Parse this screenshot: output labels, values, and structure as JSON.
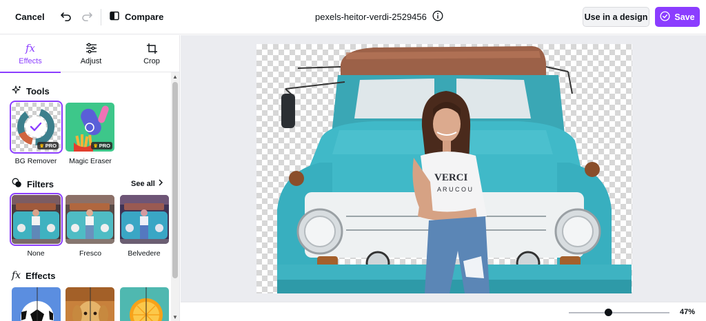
{
  "topbar": {
    "cancel_label": "Cancel",
    "compare_label": "Compare",
    "file_name": "pexels-heitor-verdi-2529456",
    "use_in_design_label": "Use in a design",
    "save_label": "Save"
  },
  "tabs": [
    {
      "label": "Effects",
      "icon": "fx-icon",
      "active": true
    },
    {
      "label": "Adjust",
      "icon": "sliders-icon",
      "active": false
    },
    {
      "label": "Crop",
      "icon": "crop-icon",
      "active": false
    }
  ],
  "sections": {
    "tools": {
      "title": "Tools",
      "items": [
        {
          "label": "BG Remover",
          "badge": "PRO",
          "selected": true
        },
        {
          "label": "Magic Eraser",
          "badge": "PRO",
          "selected": false
        }
      ]
    },
    "filters": {
      "title": "Filters",
      "see_all": "See all",
      "items": [
        {
          "label": "None",
          "selected": true
        },
        {
          "label": "Fresco",
          "selected": false
        },
        {
          "label": "Belvedere",
          "selected": false
        }
      ]
    },
    "effects": {
      "title": "Effects"
    }
  },
  "zoom": {
    "label": "47%",
    "value": 0.47
  },
  "colors": {
    "accent": "#8b3dff",
    "canvas_bg": "#ebecf0",
    "truck": "#38b8c8"
  }
}
